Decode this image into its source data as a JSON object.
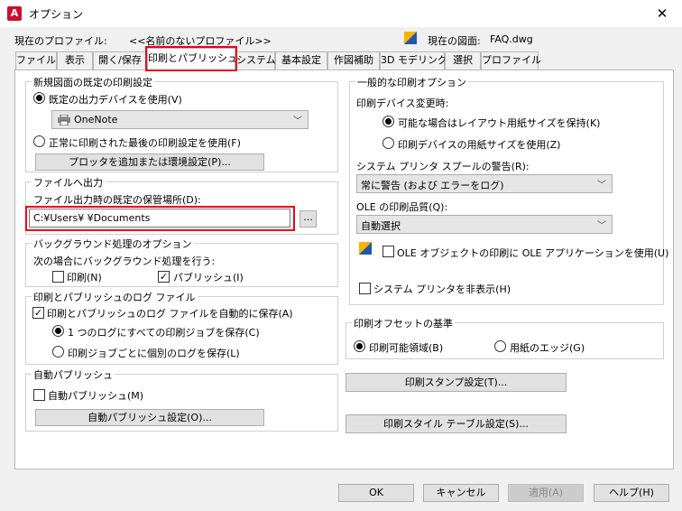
{
  "window": {
    "title": "オプション",
    "app_icon_letter": "A",
    "close_icon": "close-icon"
  },
  "profile": {
    "label": "現在のプロファイル:",
    "value": "<<名前のないプロファイル>>",
    "drawing_label": "現在の図面:",
    "drawing_value": "FAQ.dwg"
  },
  "tabs": [
    {
      "label": "ファイル"
    },
    {
      "label": "表示"
    },
    {
      "label": "開く/保存"
    },
    {
      "label": "印刷とパブリッシュ",
      "active": true
    },
    {
      "label": "システム"
    },
    {
      "label": "基本設定"
    },
    {
      "label": "作図補助"
    },
    {
      "label": "3D モデリング"
    },
    {
      "label": "選択"
    },
    {
      "label": "プロファイル"
    }
  ],
  "new_drawing_plot": {
    "title": "新規図面の既定の印刷設定",
    "radio_default_device": "既定の出力デバイスを使用(V)",
    "device_value": "OneNote",
    "radio_last_used": "正常に印刷された最後の印刷設定を使用(F)",
    "add_plotter_button": "プロッタを追加または環境設定(P)..."
  },
  "plot_to_file": {
    "title": "ファイルへ出力",
    "location_label": "ファイル出力時の既定の保管場所(D):",
    "path_value": "C:¥Users¥              ¥Documents",
    "browse_button": "..."
  },
  "background_processing": {
    "title": "バックグラウンド処理のオプション",
    "subtitle": "次の場合にバックグラウンド処理を行う:",
    "plot_label": "印刷(N)",
    "plot_checked": false,
    "publish_label": "パブリッシュ(I)",
    "publish_checked": true
  },
  "plot_log": {
    "title": "印刷とパブリッシュのログ ファイル",
    "auto_save_label": "印刷とパブリッシュのログ ファイルを自動的に保存(A)",
    "auto_save_checked": true,
    "radio_one_log": "1 つのログにすべての印刷ジョブを保存(C)",
    "radio_separate_log": "印刷ジョブごとに個別のログを保存(L)"
  },
  "auto_publish": {
    "title": "自動パブリッシュ",
    "checkbox_label": "自動パブリッシュ(M)",
    "checked": false,
    "settings_button": "自動パブリッシュ設定(O)..."
  },
  "general_plot": {
    "title": "一般的な印刷オプション",
    "device_change_label": "印刷デバイス変更時:",
    "radio_keep_layout": "可能な場合はレイアウト用紙サイズを保持(K)",
    "radio_device_paper": "印刷デバイスの用紙サイズを使用(Z)",
    "spool_label": "システム プリンタ スプールの警告(R):",
    "spool_value": "常に警告 (および エラーをログ)",
    "ole_quality_label": "OLE の印刷品質(Q):",
    "ole_quality_value": "自動選択",
    "ole_app_label": "OLE オブジェクトの印刷に OLE アプリケーションを使用(U)",
    "ole_app_checked": false,
    "hide_printers_label": "システム プリンタを非表示(H)",
    "hide_printers_checked": false
  },
  "plot_offset": {
    "title": "印刷オフセットの基準",
    "radio_printable": "印刷可能領域(B)",
    "radio_edge": "用紙のエッジ(G)"
  },
  "right_buttons": {
    "stamp": "印刷スタンプ設定(T)...",
    "style_table": "印刷スタイル テーブル設定(S)..."
  },
  "footer": {
    "ok": "OK",
    "cancel": "キャンセル",
    "apply": "適用(A)",
    "help": "ヘルプ(H)"
  },
  "colors": {
    "highlight": "#e8001c",
    "brand": "#c8102e"
  }
}
